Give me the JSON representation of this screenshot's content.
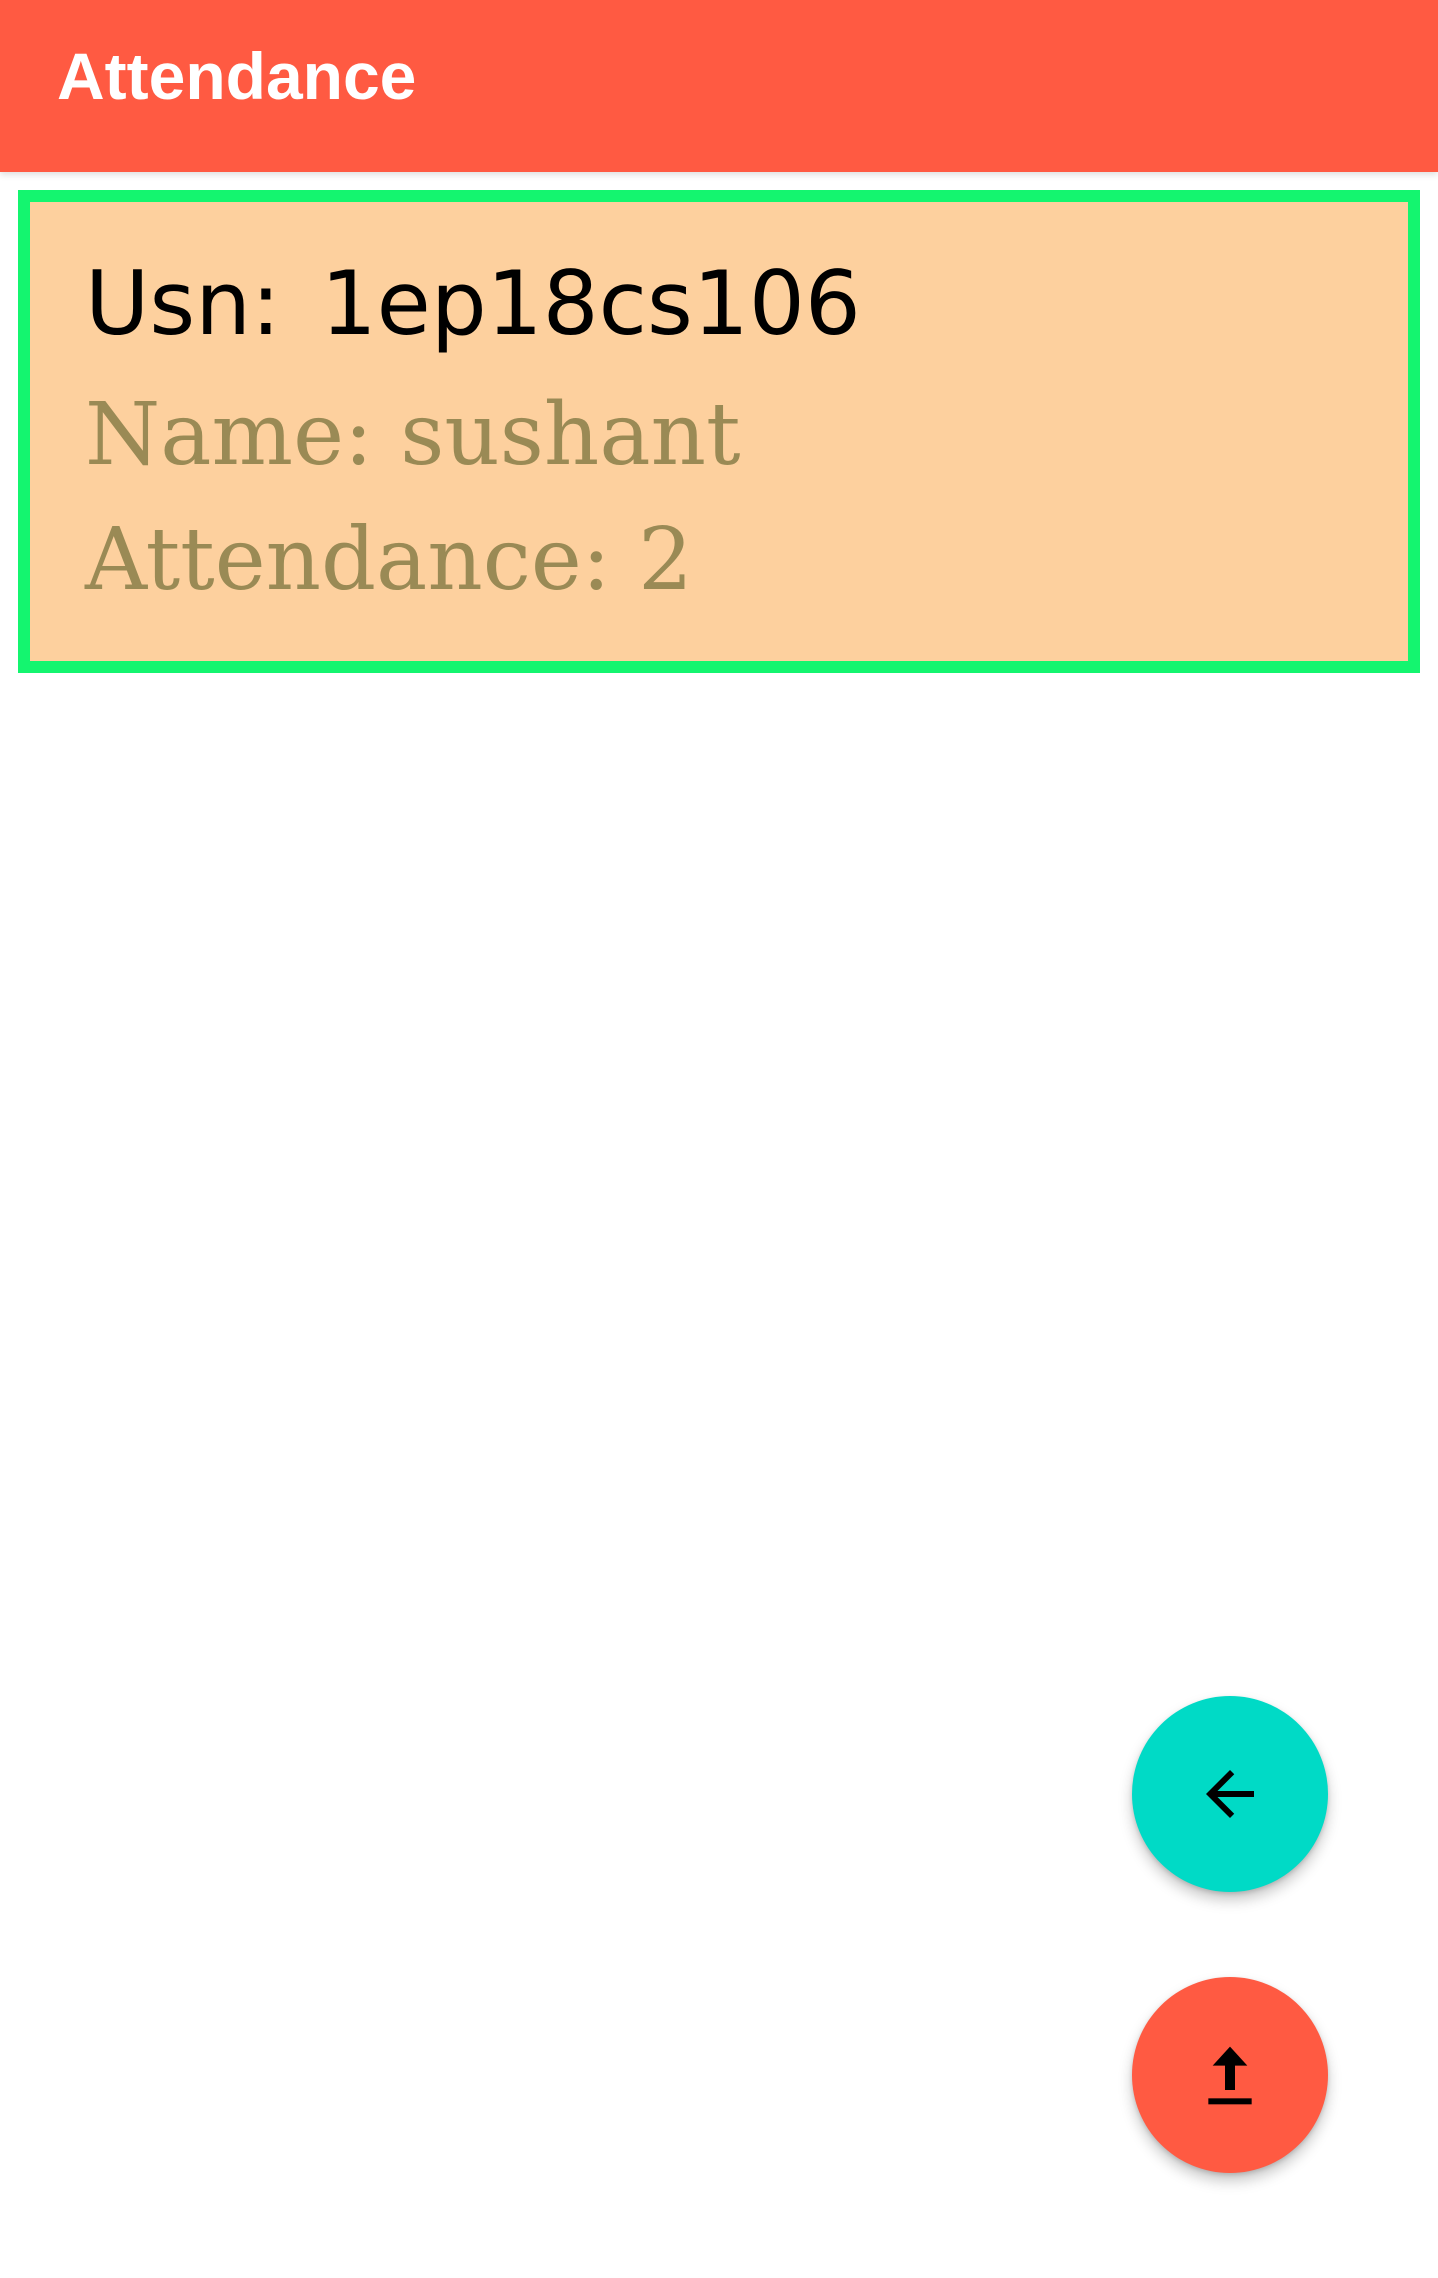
{
  "app_bar": {
    "title": "Attendance"
  },
  "record": {
    "usn_label": "Usn:",
    "usn_value": "1ep18cs106",
    "name_text": "Name: sushant",
    "attendance_text": "Attendance: 2"
  },
  "fabs": {
    "back_icon": "arrow-back-icon",
    "upload_icon": "upload-icon"
  },
  "colors": {
    "app_bar": "#FF5A42",
    "card_background": "#FDD09E",
    "card_border": "#14F56F",
    "secondary_text": "#9A8A55",
    "fab_back": "#00DAC6",
    "fab_upload": "#FF5A42"
  }
}
